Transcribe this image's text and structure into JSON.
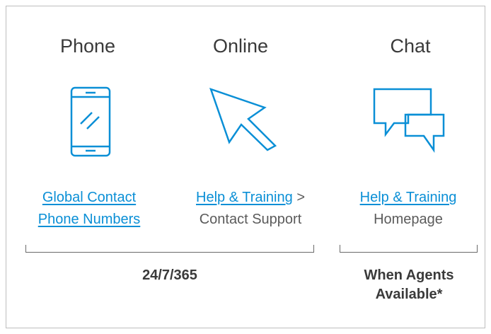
{
  "columns": {
    "phone": {
      "title": "Phone",
      "link_line1": "Global Contact ",
      "link_line2": "Phone Numbers"
    },
    "online": {
      "title": "Online",
      "link": "Help & Training",
      "separator": ">",
      "text": "Contact Support"
    },
    "chat": {
      "title": "Chat",
      "link": "Help & Training ",
      "text": "Homepage"
    }
  },
  "availability": {
    "phone_online": "24/7/365",
    "chat_line1": "When Agents",
    "chat_line2": "Available*"
  },
  "colors": {
    "accent": "#0a8fd6",
    "text": "#3a3a3a",
    "border": "#bdbdbd"
  },
  "icons": {
    "phone": "smartphone-icon",
    "online": "cursor-arrow-icon",
    "chat": "chat-bubbles-icon"
  }
}
